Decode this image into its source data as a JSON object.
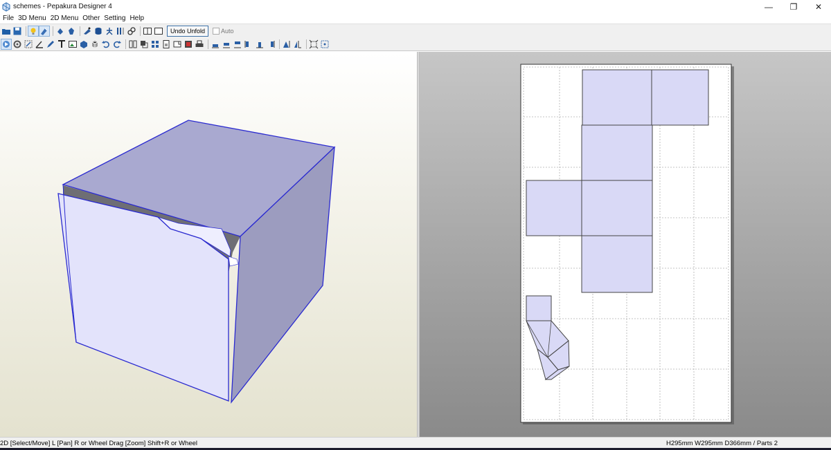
{
  "window": {
    "title": "schemes - Pepakura Designer 4",
    "controls": {
      "minimize": "—",
      "restore": "❐",
      "close": "✕"
    }
  },
  "menu": [
    "File",
    "3D Menu",
    "2D Menu",
    "Other",
    "Setting",
    "Help"
  ],
  "toolbar1": {
    "undo_unfold_label": "Undo Unfold",
    "auto_label": "Auto",
    "auto_checked": false
  },
  "status": {
    "left": "2D [Select/Move] L [Pan] R or Wheel Drag [Zoom] Shift+R or Wheel",
    "right": "H295mm W295mm D366mm / Parts 2"
  },
  "icons": {
    "toolbar1": [
      "open-folder-icon",
      "save-icon",
      "light-icon",
      "paint-icon",
      "rotate-view-icon",
      "rotate-view-alt-icon",
      "texture-icon",
      "cylinder-icon",
      "figure-icon",
      "columns-icon",
      "link-icon",
      "split-view-icon",
      "single-view-icon"
    ],
    "toolbar2": [
      "select-tool-icon",
      "gear-tool-icon",
      "edge-tool-icon",
      "angle-tool-icon",
      "pen-tool-icon",
      "text-tool-icon",
      "image-tool-icon",
      "flap-tool-icon",
      "rotate-tool-icon",
      "undo-icon",
      "redo-icon",
      "layout-icon",
      "overlap-icon",
      "grid-icon",
      "page-icon",
      "page-alt-icon",
      "page-fill-icon",
      "print-icon",
      "align-top-icon",
      "align-middle-icon",
      "align-bottom-icon",
      "align-left-icon",
      "align-center-icon",
      "align-right-icon",
      "distribute-h-icon",
      "distribute-v-icon",
      "fit-icon",
      "snap-icon"
    ]
  },
  "colors": {
    "face_light": "#e3e3fb",
    "face_top": "#a9a9d0",
    "face_right": "#9c9cbf",
    "edge": "#2a2ad0",
    "paper": "#ffffff",
    "grid_line": "#b0b0b0",
    "part_fill": "#d9d9f6"
  }
}
